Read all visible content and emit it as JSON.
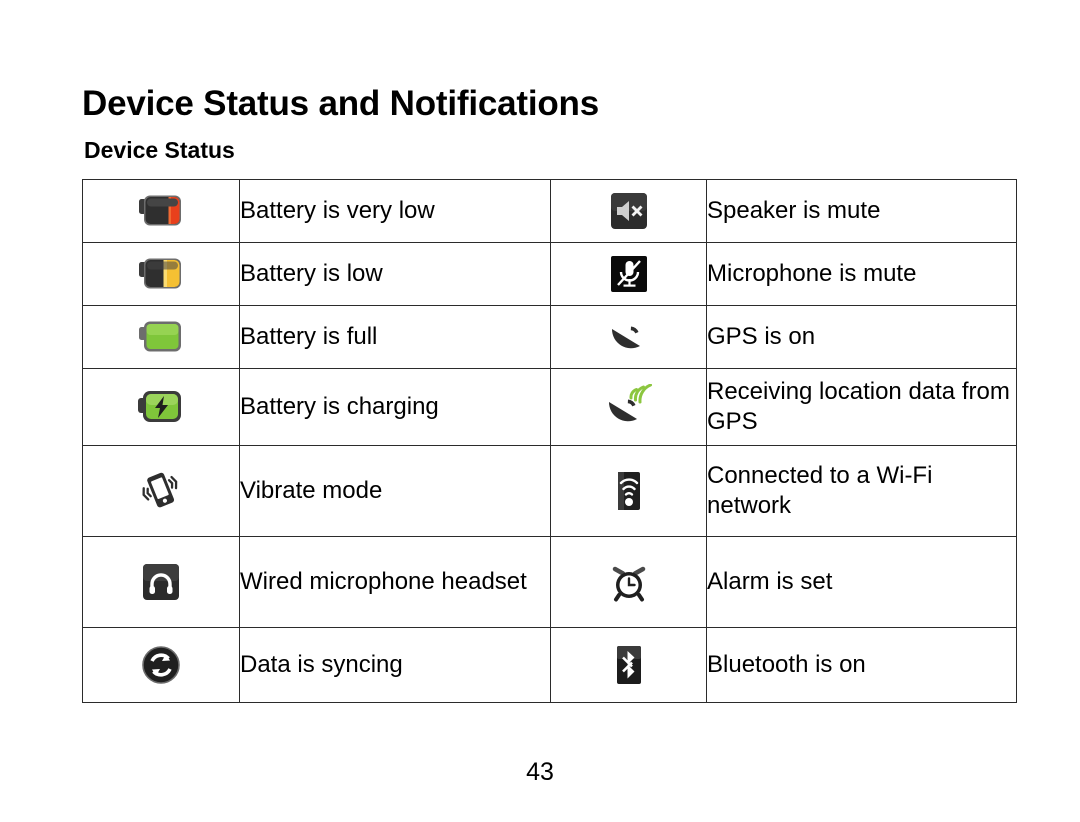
{
  "document": {
    "title": "Device Status and Notifications",
    "section_heading": "Device Status",
    "page_number": "43"
  },
  "table": {
    "rows": [
      {
        "left_icon": "battery-very-low-icon",
        "left_label": "Battery is very low",
        "right_icon": "speaker-mute-icon",
        "right_label": "Speaker is mute"
      },
      {
        "left_icon": "battery-low-icon",
        "left_label": "Battery is low",
        "right_icon": "microphone-mute-icon",
        "right_label": "Microphone is mute"
      },
      {
        "left_icon": "battery-full-icon",
        "left_label": "Battery is full",
        "right_icon": "gps-on-icon",
        "right_label": "GPS is on"
      },
      {
        "left_icon": "battery-charging-icon",
        "left_label": "Battery is charging",
        "right_icon": "gps-receiving-icon",
        "right_label": "Receiving location data from GPS"
      },
      {
        "left_icon": "vibrate-mode-icon",
        "left_label": "Vibrate mode",
        "right_icon": "wifi-connected-icon",
        "right_label": "Connected to a Wi-Fi network"
      },
      {
        "left_icon": "wired-headset-icon",
        "left_label": "Wired microphone headset",
        "right_icon": "alarm-clock-icon",
        "right_label": "Alarm is set"
      },
      {
        "left_icon": "data-sync-icon",
        "left_label": "Data is syncing",
        "right_icon": "bluetooth-on-icon",
        "right_label": "Bluetooth is on"
      }
    ]
  },
  "colors": {
    "battery_red": "#e8401c",
    "battery_amber": "#f5c033",
    "battery_green": "#7fc63a",
    "battery_body_dark": "#3b3b3b",
    "gps_signal_green": "#8cc63f",
    "icon_dark": "#2e2e2e",
    "border": "#2b2b2b",
    "text": "#000000"
  }
}
